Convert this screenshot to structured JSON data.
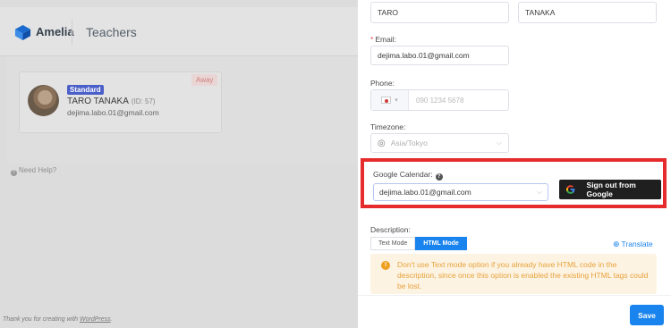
{
  "app": {
    "name": "Amelia",
    "page_title": "Teachers"
  },
  "teacher_card": {
    "badge": "Standard",
    "status": "Away",
    "name": "TARO TANAKA",
    "id_label": "(ID: 57)",
    "email": "dejima.labo.01@gmail.com"
  },
  "need_help": "Need Help?",
  "footer": {
    "text": "Thank you for creating with",
    "link": "WordPress",
    "suffix": "."
  },
  "form": {
    "first_name": "TARO",
    "last_name": "TANAKA",
    "email_label": "Email:",
    "email_value": "dejima.labo.01@gmail.com",
    "phone_label": "Phone:",
    "phone_placeholder": "090 1234 5678",
    "timezone_label": "Timezone:",
    "timezone_value": "Asia/Tokyo",
    "google_calendar_label": "Google Calendar:",
    "google_calendar_value": "dejima.labo.01@gmail.com",
    "google_button": "Sign out from Google",
    "description_label": "Description:",
    "tabs": [
      "Text Mode",
      "HTML Mode"
    ],
    "active_tab": "HTML Mode",
    "translate": "Translate",
    "notice": "Don't use Text mode option if you already have HTML code in the description, since once this option is enabled the existing HTML tags could be lost.",
    "save": "Save"
  },
  "colors": {
    "primary": "#1a84ee",
    "highlight": "#e52b2b",
    "google_button": "#1f1f1f",
    "warning": "#e6a23c"
  }
}
